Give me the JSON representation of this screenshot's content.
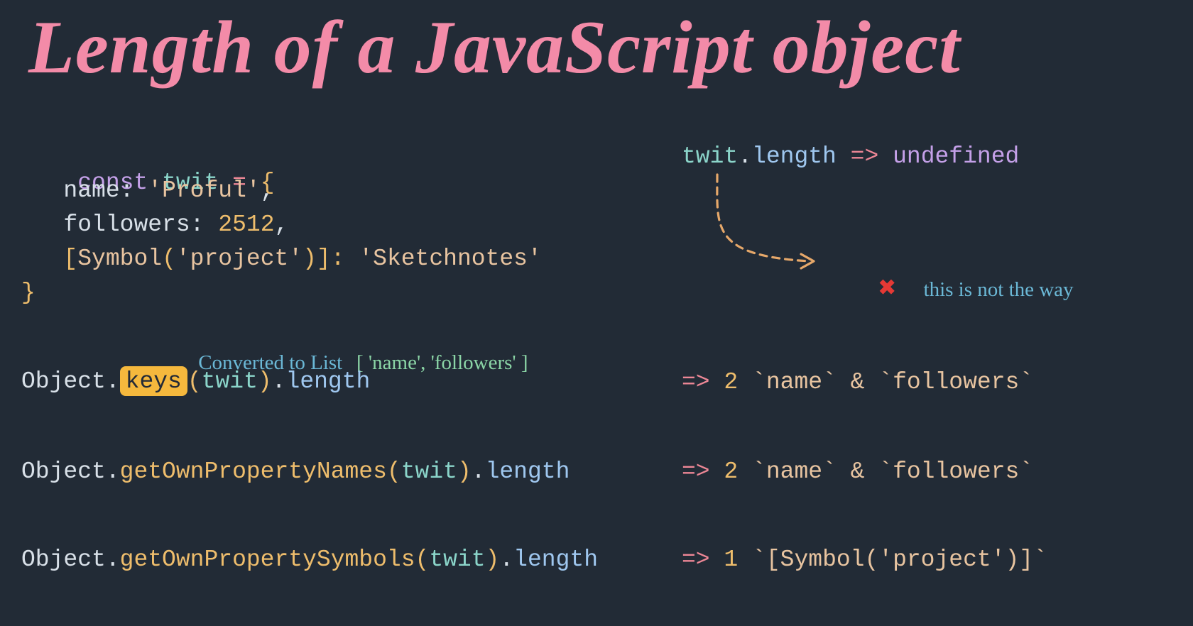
{
  "title": "Length of a JavaScript object",
  "code": {
    "kw_const": "const",
    "var": "twit",
    "eq": "=",
    "lbrace": "{",
    "name_key": "name:",
    "name_val": "'Proful'",
    "comma": ",",
    "followers_key": "followers:",
    "followers_val": "2512",
    "symbol_open": "[",
    "symbol_word": "Symbol",
    "symbol_lpar": "(",
    "symbol_arg": "'project'",
    "symbol_rpar": ")",
    "symbol_close": "]:",
    "symbol_val": "'Sketchnotes'",
    "rbrace": "}"
  },
  "right1": {
    "twit": "twit",
    "dot": ".",
    "length": "length",
    "arrow": "=>",
    "undef": "undefined"
  },
  "anno": {
    "not_the_way": "this is not the way",
    "converted": "Converted to List",
    "list": "[ 'name', 'followers' ]"
  },
  "r_keys": {
    "obj": "Object",
    "dot": ".",
    "keys": "keys",
    "lpar": "(",
    "arg": "twit",
    "rpar": ")",
    "len": "length",
    "arrow": "=>",
    "val": "2",
    "tail": "`name` & `followers`"
  },
  "r_own": {
    "obj": "Object",
    "dot": ".",
    "m": "getOwnPropertyNames",
    "lpar": "(",
    "arg": "twit",
    "rpar": ")",
    "len": "length",
    "arrow": "=>",
    "val": "2",
    "tail": "`name` & `followers`"
  },
  "r_sym": {
    "obj": "Object",
    "dot": ".",
    "m": "getOwnPropertySymbols",
    "lpar": "(",
    "arg": "twit",
    "rpar": ")",
    "len": "length",
    "arrow": "=>",
    "val": "1",
    "tail": "`[Symbol('project')]`"
  }
}
